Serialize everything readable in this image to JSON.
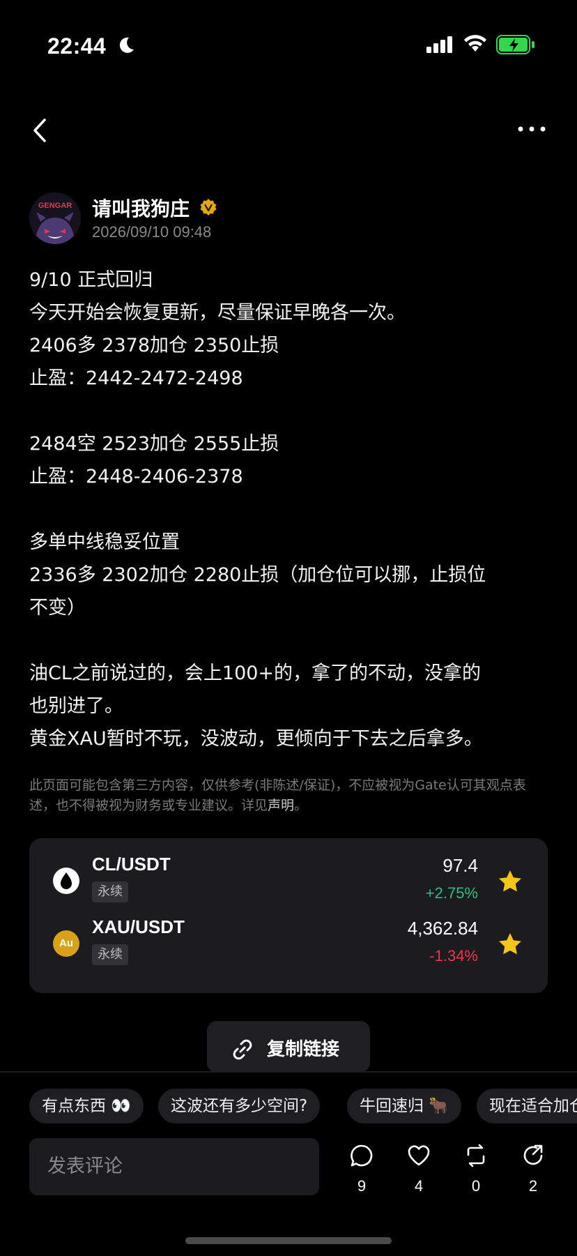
{
  "status_bar": {
    "time": "22:44"
  },
  "author": {
    "name": "请叫我狗庄",
    "avatar_text": "GENGAR",
    "time": "2026/09/10 09:48"
  },
  "post": {
    "lines": [
      "9/10  正式回归",
      "今天开始会恢复更新，尽量保证早晚各一次。",
      "2406多  2378加仓  2350止损",
      "止盈：2442-2472-2498",
      "",
      "2484空  2523加仓 2555止损",
      "止盈：2448-2406-2378",
      "",
      "多单中线稳妥位置",
      "2336多 2302加仓 2280止损（加仓位可以挪，止损位",
      "不变）",
      "",
      "油CL之前说过的，会上100+的，拿了的不动，没拿的",
      "也别进了。",
      "黄金XAU暂时不玩，没波动，更倾向于下去之后拿多。"
    ]
  },
  "disclaimer": {
    "text": "此页面可能包含第三方内容，仅供参考(非陈述/保证)，不应被视为Gate认可其观点表述，也不得被视为财务或专业建议。详见",
    "link": "声明",
    "end": "。"
  },
  "market": [
    {
      "pair": "CL/USDT",
      "tag": "永续",
      "price": "97.4",
      "change": "+2.75%",
      "direction": "up"
    },
    {
      "pair": "XAU/USDT",
      "tag": "永续",
      "price": "4,362.84",
      "change": "-1.34%",
      "direction": "down",
      "icon_text": "Au"
    }
  ],
  "copy_link": {
    "label": "复制链接"
  },
  "quick_replies": [
    "有点东西 👀",
    "这波还有多少空间?",
    "牛回速归 🐂",
    "现在适合加仓"
  ],
  "comment": {
    "placeholder": "发表评论"
  },
  "actions": {
    "comments": "9",
    "likes": "4",
    "reposts": "0",
    "shares": "2"
  },
  "colors": {
    "up": "#2ebd85",
    "down": "#f0344f",
    "star": "#f5c518",
    "verified": "#e3a70f"
  }
}
